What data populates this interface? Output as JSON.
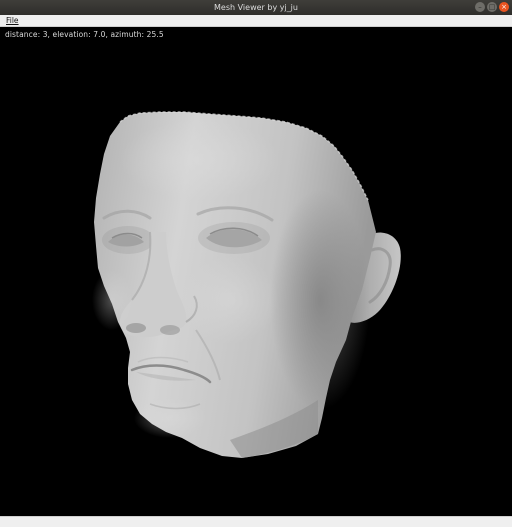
{
  "window": {
    "title": "Mesh Viewer by yj_ju",
    "controls": {
      "minimize_icon": "minimize-icon",
      "maximize_icon": "maximize-icon",
      "close_icon": "close-icon"
    }
  },
  "menubar": {
    "items": [
      {
        "label": "File"
      }
    ]
  },
  "viewport": {
    "camera_readout": "distance: 3, elevation: 7.0, azimuth: 25.5",
    "colors": {
      "background": "#000000",
      "mesh": "#c8c8c8"
    }
  }
}
